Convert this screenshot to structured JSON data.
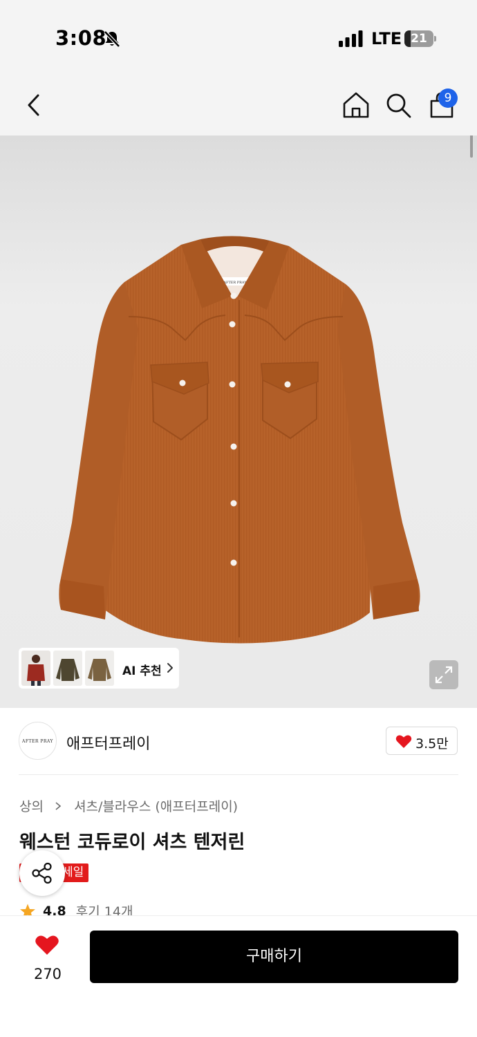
{
  "status_bar": {
    "time": "3:08",
    "network": "LTE",
    "battery": "21"
  },
  "header": {
    "cart_count": "9"
  },
  "product_image": {
    "ai_recommend_label": "AI 추천",
    "shirt_label_text": "AFTER PRAY"
  },
  "brand": {
    "logo_text": "AFTER PRAY",
    "name": "애프터프레이",
    "like_count": "3.5만"
  },
  "product": {
    "breadcrumb": [
      "상의",
      "셔츠/블라우스 (애프터프레이)"
    ],
    "title": "웨스턴 코듀로이 셔츠 텐저린",
    "sale_badge": "세일",
    "rating": "4.8",
    "reviews": "후기 14개"
  },
  "bottom_bar": {
    "like_count": "270",
    "buy_label": "구매하기"
  },
  "colors": {
    "accent_blue": "#1e63e9",
    "heart_red": "#e5161f",
    "sale_red": "#e21b1b",
    "shirt": "#b7622a"
  }
}
